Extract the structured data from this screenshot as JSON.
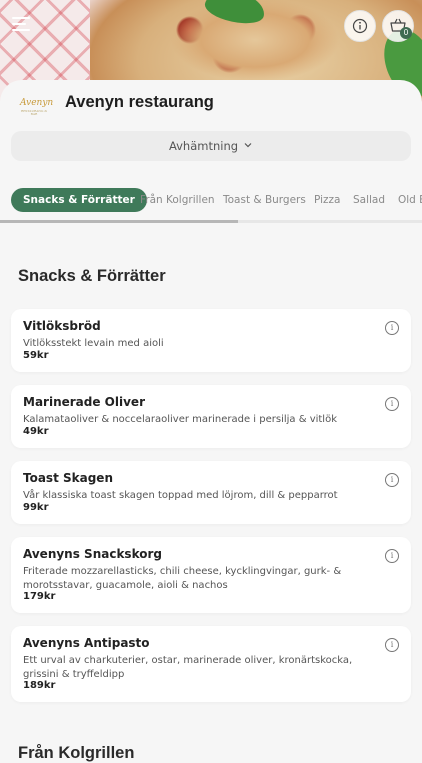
{
  "restaurant": {
    "name": "Avenyn restaurang",
    "logo_text": "Avenyn",
    "logo_subtext": "RESTAURANG & BAR"
  },
  "header": {
    "cart_count": "0"
  },
  "order_mode": {
    "label": "Avhämtning"
  },
  "tabs": [
    {
      "label": "Snacks & Förrätter",
      "active": true
    },
    {
      "label": "Från Kolgrillen",
      "active": false
    },
    {
      "label": "Toast & Burgers",
      "active": false
    },
    {
      "label": "Pizza",
      "active": false
    },
    {
      "label": "Sallad",
      "active": false
    },
    {
      "label": "Old B",
      "active": false
    }
  ],
  "sections": [
    {
      "title": "Snacks & Förrätter",
      "items": [
        {
          "name": "Vitlöksbröd",
          "description": "Vitlöksstekt levain med aioli",
          "price": "59kr"
        },
        {
          "name": "Marinerade Oliver",
          "description": "Kalamataoliver & noccelaraoliver marinerade i persilja & vitlök",
          "price": "49kr"
        },
        {
          "name": "Toast Skagen",
          "description": "Vår klassiska toast skagen toppad med löjrom, dill & pepparrot",
          "price": "99kr"
        },
        {
          "name": "Avenyns Snackskorg",
          "description": "Friterade mozzarellasticks, chili cheese, kycklingvingar, gurk- & morotsstavar, guacamole, aioli & nachos",
          "price": "179kr"
        },
        {
          "name": "Avenyns Antipasto",
          "description": "Ett urval av charkuterier, ostar, marinerade oliver, kronärtskocka, grissini & tryffeldipp",
          "price": "189kr"
        }
      ]
    },
    {
      "title": "Från Kolgrillen"
    }
  ],
  "colors": {
    "accent": "#3f7a5a",
    "background": "#f6f6f6",
    "card": "#ffffff"
  },
  "icons": {
    "menu": "hamburger-icon",
    "info": "info-icon",
    "cart": "basket-icon",
    "chevron": "chevron-down-icon"
  }
}
